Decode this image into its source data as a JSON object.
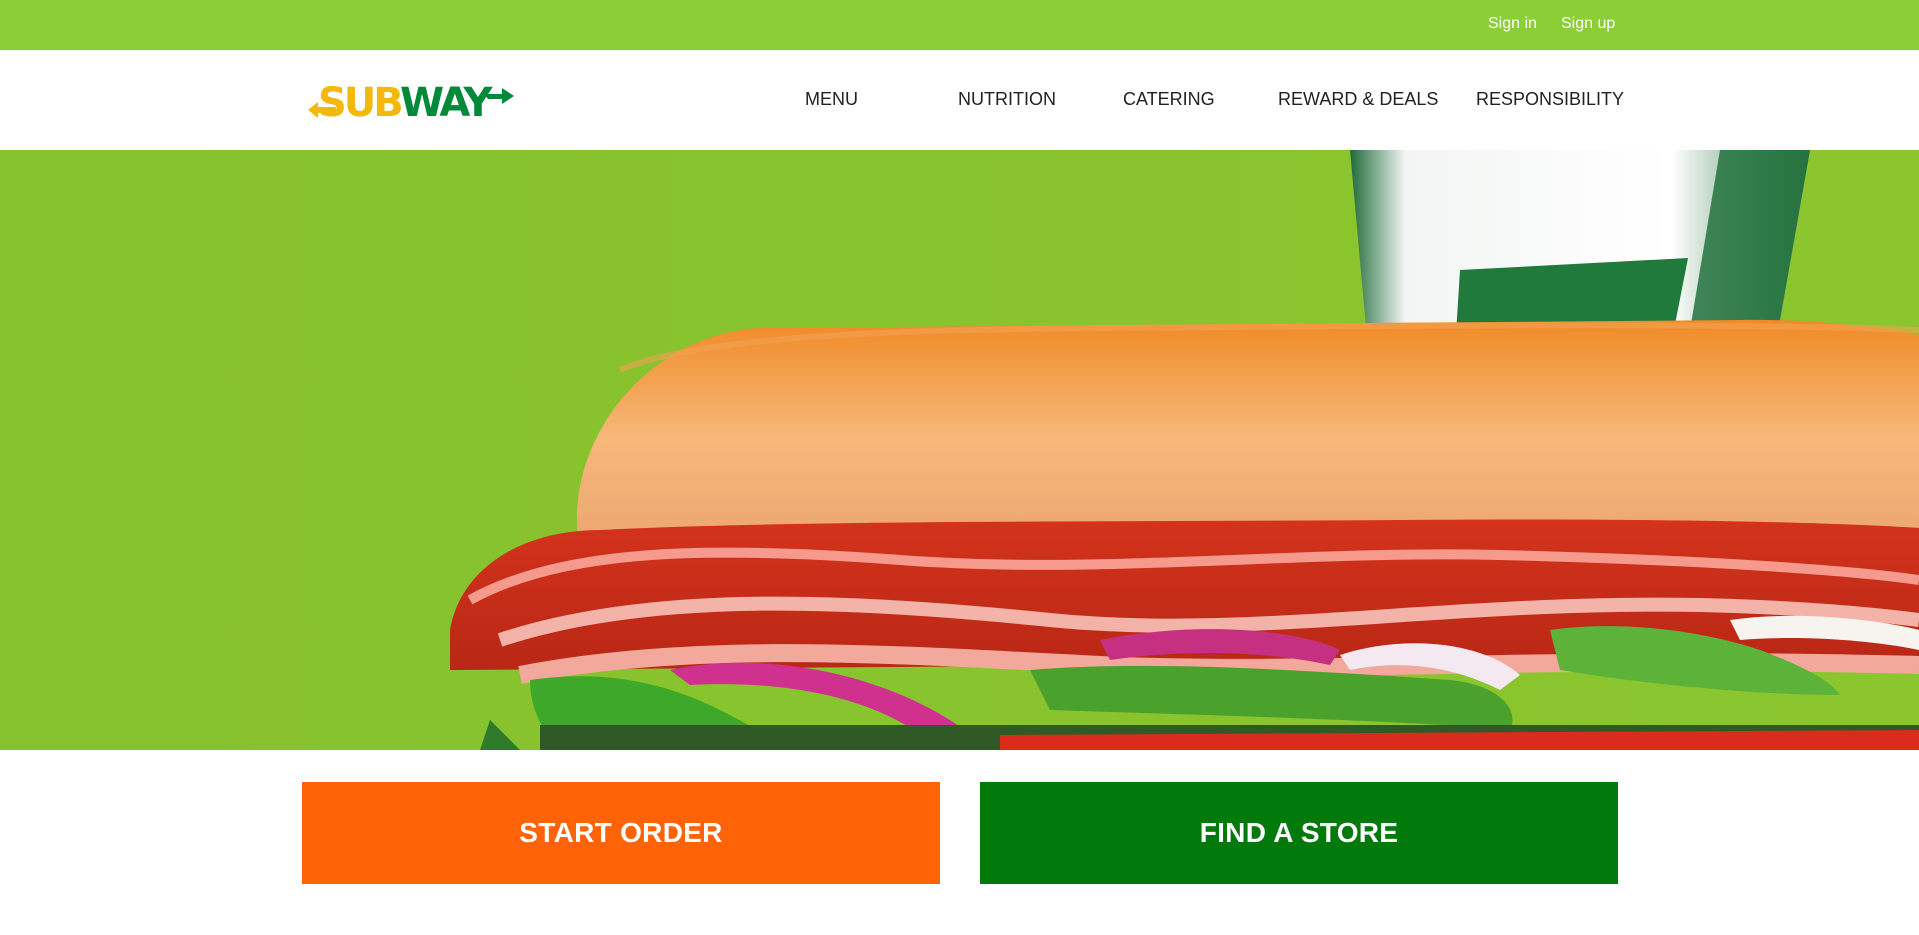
{
  "colors": {
    "top_bar": "#8cce36",
    "hero_background": "#86c22d",
    "brand_yellow": "#f2b90b",
    "brand_green": "#008938",
    "start_order": "#ff6308",
    "find_store": "#017a0b"
  },
  "account": {
    "sign_in": "Sign in",
    "sign_up": "Sign up"
  },
  "logo": {
    "text": "SUBWAY",
    "part_yellow": "SUB",
    "part_green": "WAY"
  },
  "nav": {
    "menu": "MENU",
    "nutrition": "NUTRITION",
    "catering": "CATERING",
    "rewards": "REWARD & DEALS",
    "responsibility": "RESPONSIBILITY"
  },
  "hero": {
    "image": "sandwich-and-cup-photo"
  },
  "actions": {
    "start_order": "START ORDER",
    "find_store": "FIND A STORE"
  }
}
